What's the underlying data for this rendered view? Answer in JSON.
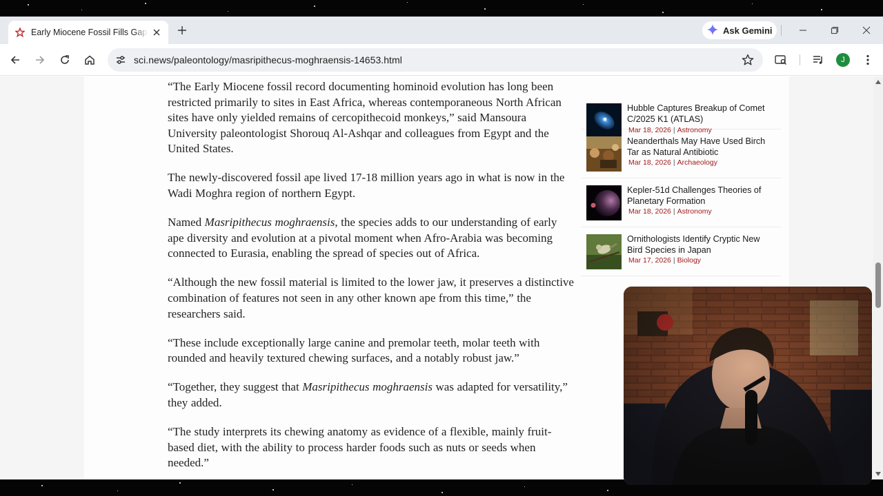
{
  "browser": {
    "tab": {
      "title": "Early Miocene Fossil Fills Gap in",
      "favicon": "sci-news-star-icon"
    },
    "gemini_label": "Ask Gemini",
    "url": "sci.news/paleontology/masripithecus-moghraensis-14653.html",
    "profile_initial": "J"
  },
  "article": {
    "paragraphs": [
      "“The Early Miocene fossil record documenting hominoid evolution has long been restricted primarily to sites in East Africa, whereas contemporaneous North African sites have only yielded remains of cercopithecoid monkeys,” said Mansoura University paleontologist Shorouq Al-Ashqar and colleagues from Egypt and the United States.",
      "The newly-discovered fossil ape lived 17-18 million years ago in what is now in the Wadi Moghra region of northern Egypt.",
      "“Although the new fossil material is limited to the lower jaw, it preserves a distinctive combination of features not seen in any other known ape from this time,” the researchers said.",
      "“These include exceptionally large canine and premolar teeth, molar teeth with rounded and heavily textured chewing surfaces, and a notably robust jaw.”",
      "“The study interprets its chewing anatomy as evidence of a flexible, mainly fruit-based diet, with the ability to process harder foods such as nuts or seeds when needed.”"
    ],
    "named_para": {
      "before": "Named ",
      "species": "Masripithecus moghraensis",
      "after": ", the species adds to our understanding of early ape diversity and evolution at a pivotal moment when Afro-Arabia was becoming connected to Eurasia, enabling the spread of species out of Africa."
    },
    "together_para": {
      "before": "“Together, they suggest that ",
      "species": "Masripithecus moghraensis",
      "after": " was adapted for versatility,” they added."
    }
  },
  "sidebar": {
    "items": [
      {
        "title": "Hubble Captures Breakup of Comet C/2025 K1 (ATLAS)",
        "date": "Mar 18, 2026",
        "separator": "|",
        "category": "Astronomy"
      },
      {
        "title": "Neanderthals May Have Used Birch Tar as Natural Antibiotic",
        "date": "Mar 18, 2026",
        "separator": "|",
        "category": "Archaeology"
      },
      {
        "title": "Kepler-51d Challenges Theories of Planetary Formation",
        "date": "Mar 18, 2026",
        "separator": "|",
        "category": "Astronomy"
      },
      {
        "title": "Ornithologists Identify Cryptic New Bird Species in Japan",
        "date": "Mar 17, 2026",
        "separator": "|",
        "category": "Biology"
      }
    ]
  },
  "colors": {
    "category_link": "#a11b1b",
    "tabstrip_bg": "#e6e9ee",
    "omnibox_bg": "#eef0f3",
    "profile_bg": "#1e8e3e"
  }
}
